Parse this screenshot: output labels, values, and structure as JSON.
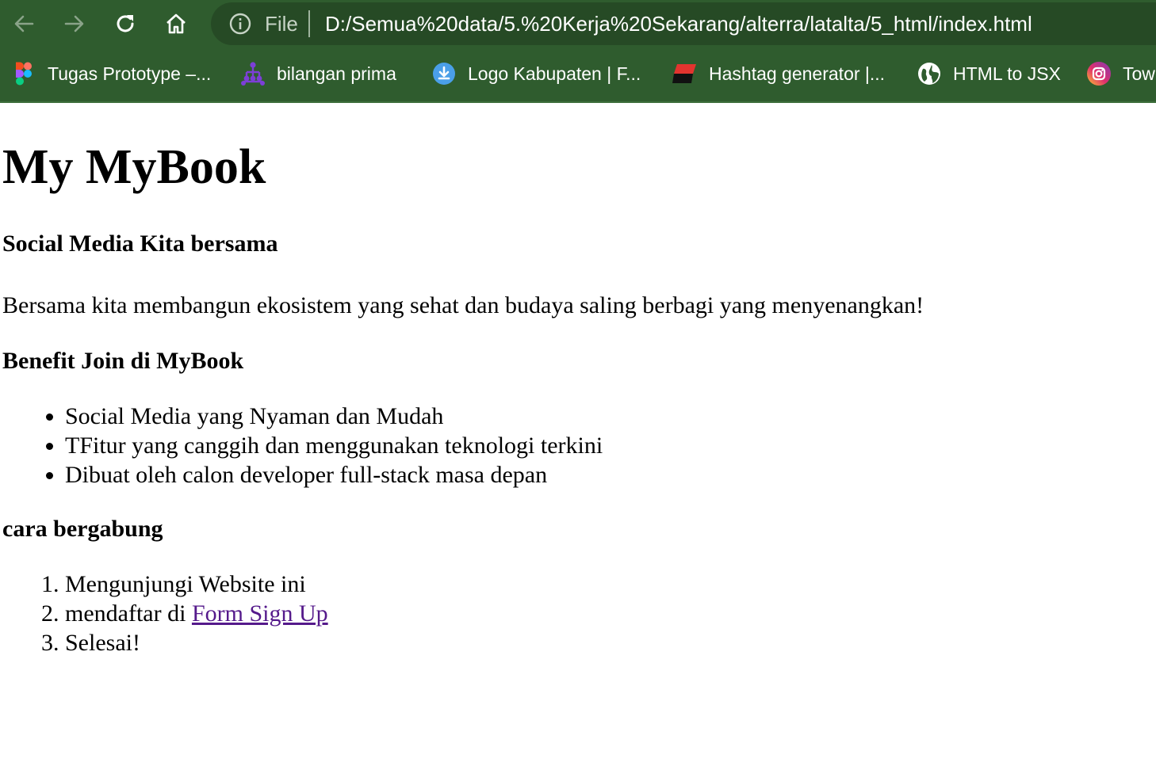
{
  "browser": {
    "scheme_label": "File",
    "url": "D:/Semua%20data/5.%20Kerja%20Sekarang/alterra/latalta/5_html/index.html",
    "icons": [
      "back-arrow-icon",
      "forward-arrow-icon",
      "reload-icon",
      "home-icon",
      "info-icon"
    ]
  },
  "bookmarks": [
    {
      "label": "Tugas Prototype –...",
      "icon": "figma-icon"
    },
    {
      "label": "bilangan prima",
      "icon": "hierarchy-icon"
    },
    {
      "label": "Logo Kabupaten | F...",
      "icon": "download-icon"
    },
    {
      "label": "Hashtag generator |...",
      "icon": "flag-stripes-icon"
    },
    {
      "label": "HTML to JSX",
      "icon": "globe-icon"
    },
    {
      "label": "Tow",
      "icon": "instagram-icon"
    }
  ],
  "page": {
    "title": "My MyBook",
    "subtitle": "Social Media Kita bersama",
    "lead": "Bersama kita membangun ekosistem yang sehat dan budaya saling berbagi yang menyenangkan!",
    "benefits_heading": "Benefit Join di MyBook",
    "benefits": [
      "Social Media yang Nyaman dan Mudah",
      "TFitur yang canggih dan menggunakan teknologi terkini",
      "Dibuat oleh calon developer full-stack masa depan"
    ],
    "join_heading": "cara bergabung",
    "steps": {
      "step1": "Mengunjungi Website ini",
      "step2_prefix": "mendaftar di ",
      "step2_link": "Form Sign Up",
      "step3": "Selesai!"
    }
  },
  "colors": {
    "chrome": "#2f5c2e",
    "omnibox": "#264a25",
    "link_visited": "#551a8b"
  }
}
